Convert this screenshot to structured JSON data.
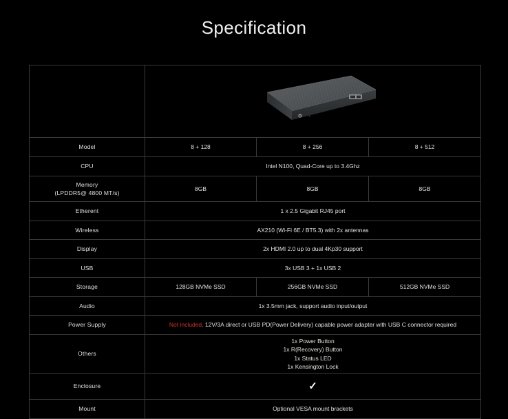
{
  "page": {
    "title": "Specification",
    "background_color": "#000000",
    "text_color": "#e4e2df",
    "accent_red": "#d0342c",
    "grid_color": "#3a3a3a"
  },
  "product_image": {
    "alt_name": "mini-pc-device",
    "description": "Dark grey mini PC with ribbed top surface, front power button and side label",
    "body_color": "#4a4d50",
    "top_color": "#53575a",
    "front_color": "#2e3133"
  },
  "table": {
    "columns": [
      "",
      "8 + 128",
      "8 + 256",
      "8 + 512"
    ],
    "rows": [
      {
        "label": "Model",
        "label_sub": "",
        "type": "split",
        "values": [
          "8 + 128",
          "8 + 256",
          "8 + 512"
        ]
      },
      {
        "label": "CPU",
        "label_sub": "",
        "type": "merged",
        "value": "Intel N100, Quad-Core up to 3.4Ghz"
      },
      {
        "label": "Memory",
        "label_sub": "(LPDDR5@ 4800 MT/s)",
        "type": "split",
        "values": [
          "8GB",
          "8GB",
          "8GB"
        ]
      },
      {
        "label": "Etherent",
        "label_sub": "",
        "type": "merged",
        "value": "1 x 2.5 Gigabit RJ45 port"
      },
      {
        "label": "Wireless",
        "label_sub": "",
        "type": "merged",
        "value": "AX210 (Wi-Fi 6E / BT5.3) with 2x antennas"
      },
      {
        "label": "Display",
        "label_sub": "",
        "type": "merged",
        "value": "2x HDMI 2.0 up to dual 4Kp30 support"
      },
      {
        "label": "USB",
        "label_sub": "",
        "type": "merged",
        "value": "3x USB 3 + 1x USB 2"
      },
      {
        "label": "Storage",
        "label_sub": "",
        "type": "split",
        "values": [
          "128GB NVMe SSD",
          "256GB NVMe SSD",
          "512GB NVMe SSD"
        ]
      },
      {
        "label": "Audio",
        "label_sub": "",
        "type": "merged",
        "value": "1x 3.5mm jack, support audio input/output"
      },
      {
        "label": "Power Supply",
        "label_sub": "",
        "type": "merged_rich",
        "value_highlight": "Not included,",
        "value": "12V/3A direct or USB PD(Power Delivery) capable power adapter with USB C connector required"
      },
      {
        "label": "Others",
        "label_sub": "",
        "type": "merged_multiline",
        "lines": [
          "1x Power Button",
          "1x R(Recovery) Button",
          "1x Status LED",
          "1x Kensington Lock"
        ]
      },
      {
        "label": "Enclosure",
        "label_sub": "",
        "type": "merged_icon",
        "icon": "check-mark"
      },
      {
        "label": "Mount",
        "label_sub": "",
        "type": "merged",
        "value": "Optional VESA mount brackets"
      }
    ]
  }
}
